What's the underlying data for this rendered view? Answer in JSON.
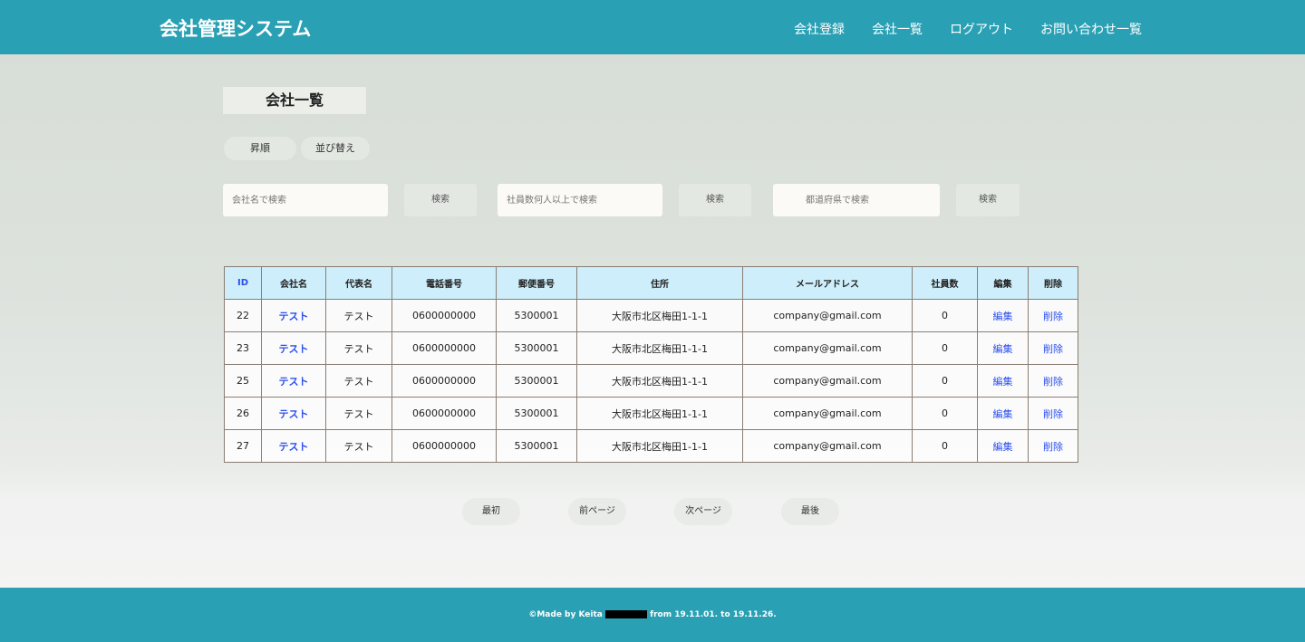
{
  "header": {
    "brand": "会社管理システム",
    "nav": [
      "会社登録",
      "会社一覧",
      "ログアウト",
      "お問い合わせ一覧"
    ]
  },
  "page_title": "会社一覧",
  "sort": {
    "asc": "昇順",
    "sort": "並び替え"
  },
  "search": {
    "name_placeholder": "会社名で検索",
    "employees_placeholder": "社員数何人以上で検索",
    "prefecture_placeholder": "都道府県で検索",
    "button": "検索"
  },
  "table": {
    "headers": [
      "ID",
      "会社名",
      "代表名",
      "電話番号",
      "郵便番号",
      "住所",
      "メールアドレス",
      "社員数",
      "編集",
      "削除"
    ],
    "rows": [
      [
        "22",
        "テスト",
        "テスト",
        "0600000000",
        "5300001",
        "大阪市北区梅田1-1-1",
        "company@gmail.com",
        "0",
        "編集",
        "削除"
      ],
      [
        "23",
        "テスト",
        "テスト",
        "0600000000",
        "5300001",
        "大阪市北区梅田1-1-1",
        "company@gmail.com",
        "0",
        "編集",
        "削除"
      ],
      [
        "25",
        "テスト",
        "テスト",
        "0600000000",
        "5300001",
        "大阪市北区梅田1-1-1",
        "company@gmail.com",
        "0",
        "編集",
        "削除"
      ],
      [
        "26",
        "テスト",
        "テスト",
        "0600000000",
        "5300001",
        "大阪市北区梅田1-1-1",
        "company@gmail.com",
        "0",
        "編集",
        "削除"
      ],
      [
        "27",
        "テスト",
        "テスト",
        "0600000000",
        "5300001",
        "大阪市北区梅田1-1-1",
        "company@gmail.com",
        "0",
        "編集",
        "削除"
      ]
    ]
  },
  "pagination": [
    "最初",
    "前ページ",
    "次ページ",
    "最後"
  ],
  "footer": {
    "prefix": "©Made by Keita",
    "suffix": "from 19.11.01. to 19.11.26."
  }
}
